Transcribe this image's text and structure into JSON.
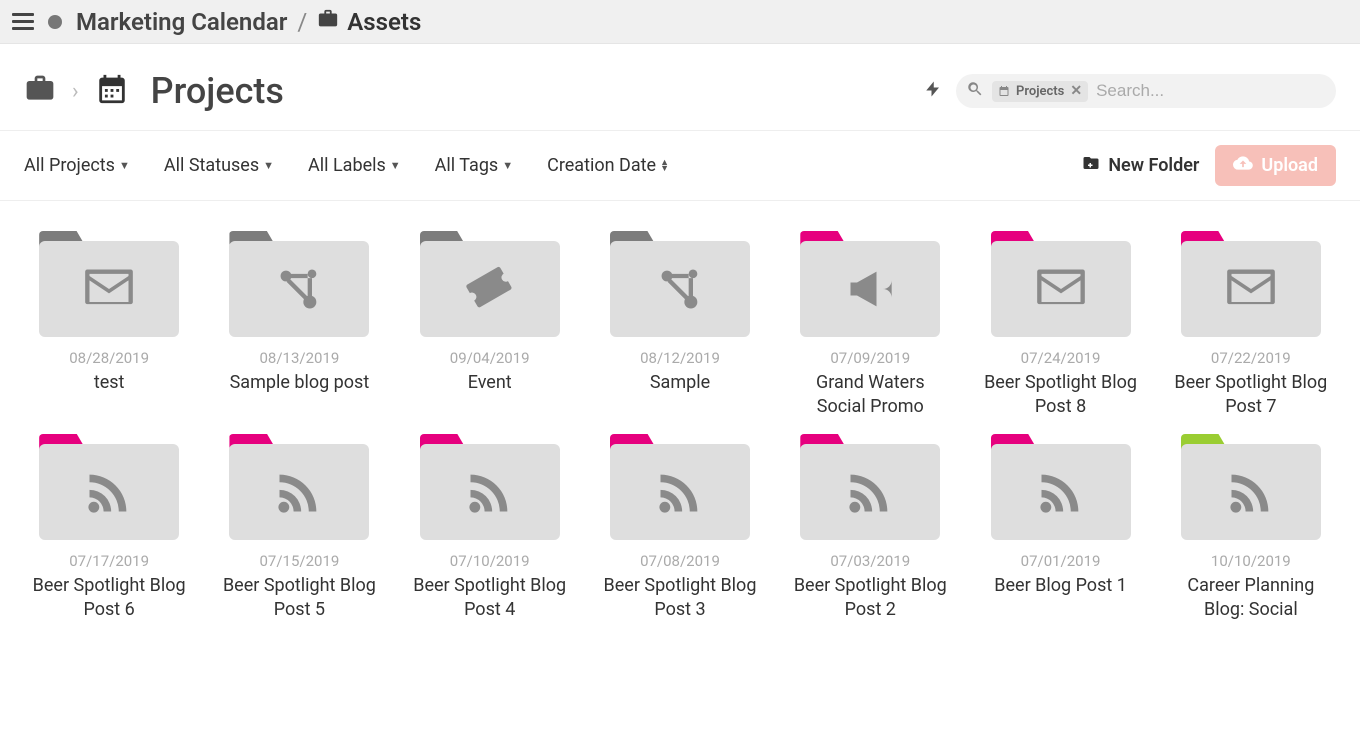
{
  "topbar": {
    "crumb1": "Marketing Calendar",
    "sep": "/",
    "crumb2": "Assets"
  },
  "subhead": {
    "title": "Projects",
    "search_chip": "Projects",
    "search_placeholder": "Search..."
  },
  "filters": {
    "projects": "All Projects",
    "statuses": "All Statuses",
    "labels": "All Labels",
    "tags": "All Tags",
    "sort": "Creation Date"
  },
  "actions": {
    "new_folder": "New Folder",
    "upload": "Upload"
  },
  "items": [
    {
      "date": "08/28/2019",
      "name": "test",
      "icon": "mail",
      "tab": "gray"
    },
    {
      "date": "08/13/2019",
      "name": "Sample blog post",
      "icon": "hub",
      "tab": "gray"
    },
    {
      "date": "09/04/2019",
      "name": "Event",
      "icon": "ticket",
      "tab": "gray"
    },
    {
      "date": "08/12/2019",
      "name": "Sample",
      "icon": "hub",
      "tab": "gray"
    },
    {
      "date": "07/09/2019",
      "name": "Grand Waters Social Promo",
      "icon": "megaphone",
      "tab": "pink"
    },
    {
      "date": "07/24/2019",
      "name": "Beer Spotlight Blog Post 8",
      "icon": "mail",
      "tab": "pink"
    },
    {
      "date": "07/22/2019",
      "name": "Beer Spotlight Blog Post 7",
      "icon": "mail",
      "tab": "pink"
    },
    {
      "date": "07/17/2019",
      "name": "Beer Spotlight Blog Post 6",
      "icon": "rss",
      "tab": "pink"
    },
    {
      "date": "07/15/2019",
      "name": "Beer Spotlight Blog Post 5",
      "icon": "rss",
      "tab": "pink"
    },
    {
      "date": "07/10/2019",
      "name": "Beer Spotlight Blog Post 4",
      "icon": "rss",
      "tab": "pink"
    },
    {
      "date": "07/08/2019",
      "name": "Beer Spotlight Blog Post 3",
      "icon": "rss",
      "tab": "pink"
    },
    {
      "date": "07/03/2019",
      "name": "Beer Spotlight Blog Post 2",
      "icon": "rss",
      "tab": "pink"
    },
    {
      "date": "07/01/2019",
      "name": "Beer Blog Post 1",
      "icon": "rss",
      "tab": "pink"
    },
    {
      "date": "10/10/2019",
      "name": "Career Planning Blog: Social",
      "icon": "rss",
      "tab": "green"
    }
  ]
}
